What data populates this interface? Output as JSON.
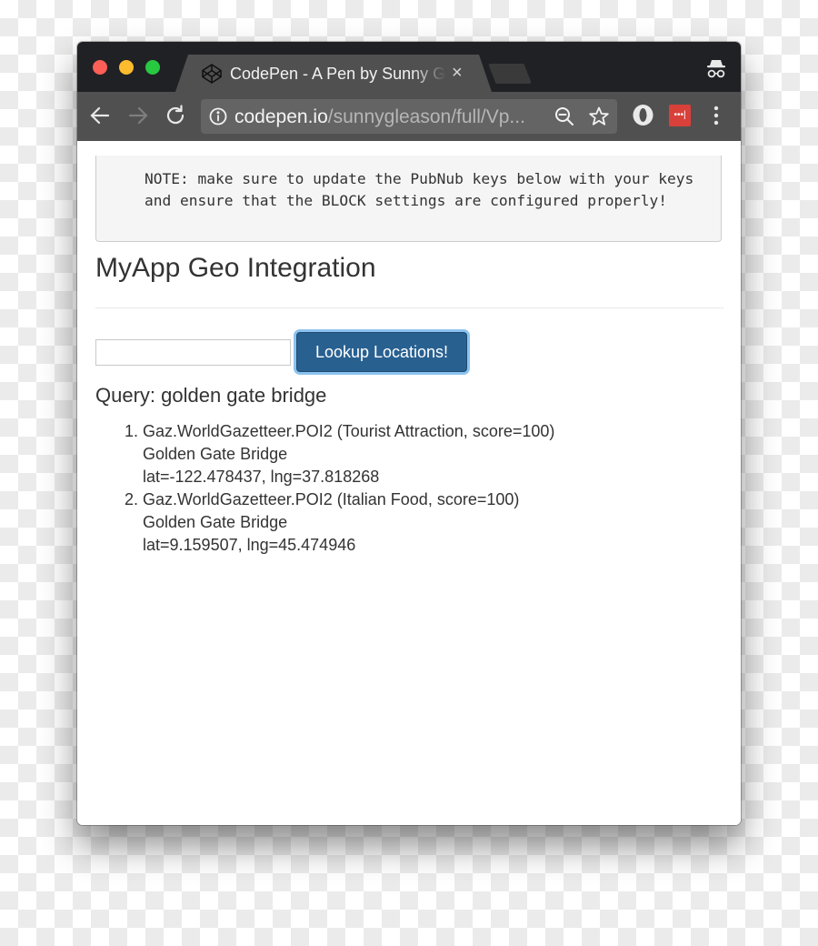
{
  "browser": {
    "tab": {
      "title": "CodePen - A Pen by Sunny Gleason",
      "icon": "codepen-logo-icon",
      "close_label": "×"
    },
    "url": {
      "host": "codepen.io",
      "path": "/sunnygleason/full/Vp..."
    },
    "toolbar_icons": [
      "back-arrow-icon",
      "forward-arrow-icon",
      "reload-icon",
      "info-icon",
      "zoom-out-icon",
      "star-icon",
      "opera-extension-icon",
      "lastpass-extension-icon",
      "menu-dots-icon",
      "incognito-icon"
    ],
    "lastpass_label": "•••|"
  },
  "page": {
    "note": "NOTE: make sure to update the PubNub keys below with your keys\nand ensure that the BLOCK settings are configured properly!",
    "title": "MyApp Geo Integration",
    "search": {
      "value": "",
      "placeholder": ""
    },
    "lookup_button": "Lookup Locations!",
    "query_label": "Query: golden gate bridge",
    "results": [
      {
        "source": "Gaz.WorldGazetteer.POI2 (Tourist Attraction, score=100)",
        "name": "Golden Gate Bridge",
        "coords": "lat=-122.478437, lng=37.818268"
      },
      {
        "source": "Gaz.WorldGazetteer.POI2 (Italian Food, score=100)",
        "name": "Golden Gate Bridge",
        "coords": "lat=9.159507, lng=45.474946"
      }
    ]
  }
}
